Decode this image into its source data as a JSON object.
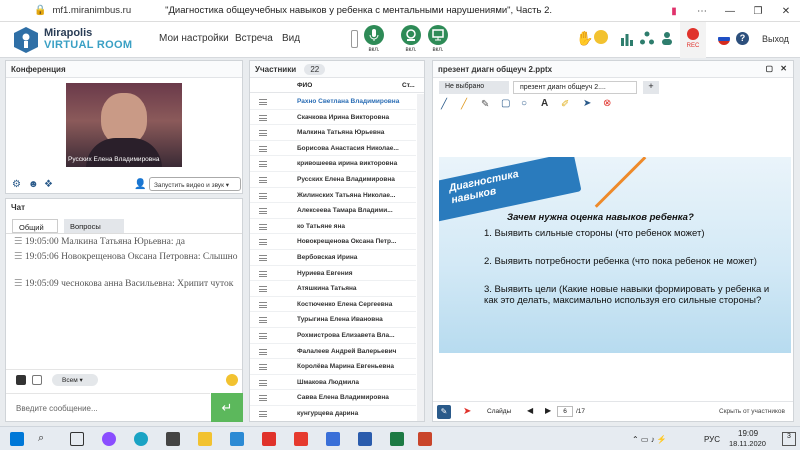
{
  "browser": {
    "url": "mf1.miranimbus.ru",
    "title": "\"Диагностика общеучебных навыков у ребенка с ментальными нарушениями\", Часть 2."
  },
  "logo": {
    "line1": "Mirapolis",
    "line2": "VIRTUAL ROOM"
  },
  "menu": {
    "settings": "Мои настройки",
    "meeting": "Встреча",
    "view": "Вид"
  },
  "toggles": {
    "mic": "вкл.",
    "cam": "вкл.",
    "screen": "вкл."
  },
  "rec": "REC",
  "exit": "Выход",
  "conference": {
    "title": "Конференция",
    "video_name": "Русских Елена Владимировна",
    "start_button": "Запустить видео и звук"
  },
  "chat": {
    "title": "Чат",
    "tabs": [
      "Общий",
      "Вопросы"
    ],
    "messages": [
      {
        "time": "19:05:00",
        "author": "Малкина Татьяна  Юрьевна:",
        "text": "да"
      },
      {
        "time": "19:05:06",
        "author": "Новокрещенова  Оксана Петровна:",
        "text": "Слышно"
      },
      {
        "time": "19:05:09",
        "author": "чеснокова  анна Васильевна:",
        "text": "Хрипит чуток"
      }
    ],
    "recipient": "Всем",
    "input_placeholder": "Введите сообщение..."
  },
  "participants": {
    "title": "Участники",
    "count": "22",
    "col_name": "ФИО",
    "col_status": "Ст...",
    "list": [
      "Рахно Светлана  Владимировна",
      "Скачкова  Ирина Викторовна",
      "Малкина Татьяна  Юрьевна",
      "Борисова  Анастасия Николае...",
      "кривошеева ирина викторовна",
      "Русских Елена Владимировна",
      "Жилинских  Татьяна  Николае...",
      "Алексеева  Тамара  Владими...",
      "ко Татьяне яна",
      "Новокрещенова  Оксана Петр...",
      "Вербовская Ирина",
      "Нуриева Евгения",
      "Атяшкина Татьяна",
      "Костюченко  Елена Сергеевна",
      "Турыгина  Елена  Ивановна",
      "Рохмистрова  Елизавета Вла...",
      "Фалалеев  Андрей  Валерьевич",
      "Королёва Марина Евгеньевна",
      "Шмакова Людмила",
      "Савва Елена Владимировна",
      "кунгурцева   дарина"
    ]
  },
  "presentation": {
    "title": "презент диагн общеуч 2.pptx",
    "tabs": [
      "Не выбрано",
      "презент диагн общеуч 2...."
    ],
    "add_tab": "+",
    "slide": {
      "heading": "Диагностика навыков",
      "question": "Зачем нужна оценка навыков ребенка?",
      "points": [
        "1. Выявить сильные стороны (что ребенок может)",
        "2. Выявить потребности ребенка (что пока ребенок не может)",
        "3. Выявить цели (Какие новые навыки формировать у ребенка и как это делать, максимально используя его сильные стороны?"
      ]
    },
    "footer": {
      "slides": "Слайды",
      "page": "6",
      "total": "/17",
      "hide": "Скрыть от участников"
    }
  },
  "taskbar": {
    "time": "19:09",
    "date": "18.11.2020",
    "lang": "РУС",
    "notification_count": "3",
    "colors": {
      "accent": "#0078d7"
    }
  }
}
